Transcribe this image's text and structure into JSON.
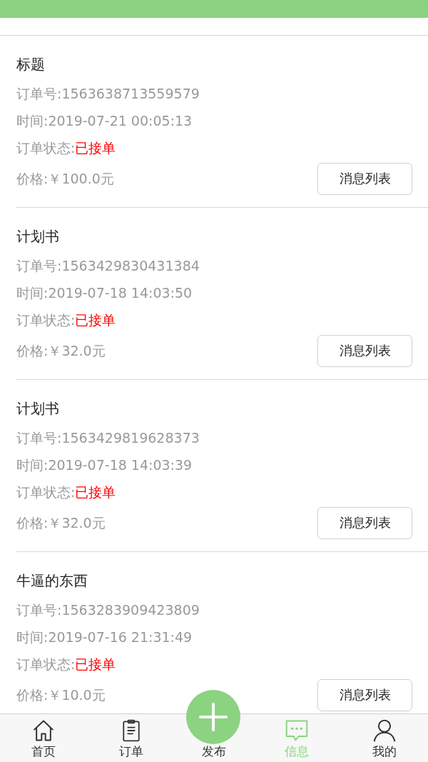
{
  "orders": [
    {
      "title": "标题",
      "order_no": "订单号:1563638713559579",
      "time": "时间:2019-07-21 00:05:13",
      "status_label": "订单状态:",
      "status": "已接单",
      "price": "价格:￥100.0元",
      "button": "消息列表"
    },
    {
      "title": "计划书",
      "order_no": "订单号:1563429830431384",
      "time": "时间:2019-07-18 14:03:50",
      "status_label": "订单状态:",
      "status": "已接单",
      "price": "价格:￥32.0元",
      "button": "消息列表"
    },
    {
      "title": "计划书",
      "order_no": "订单号:1563429819628373",
      "time": "时间:2019-07-18 14:03:39",
      "status_label": "订单状态:",
      "status": "已接单",
      "price": "价格:￥32.0元",
      "button": "消息列表"
    },
    {
      "title": "牛逼的东西",
      "order_no": "订单号:1563283909423809",
      "time": "时间:2019-07-16 21:31:49",
      "status_label": "订单状态:",
      "status": "已接单",
      "price": "价格:￥10.0元",
      "button": "消息列表"
    }
  ],
  "tab_bar": [
    {
      "kind": "home",
      "label": "首页",
      "selected": false
    },
    {
      "kind": "orders",
      "label": "订单",
      "selected": false
    },
    {
      "kind": "publish",
      "label": "发布",
      "selected": false
    },
    {
      "kind": "messages",
      "label": "信息",
      "selected": true
    },
    {
      "kind": "profile",
      "label": "我的",
      "selected": false
    }
  ]
}
